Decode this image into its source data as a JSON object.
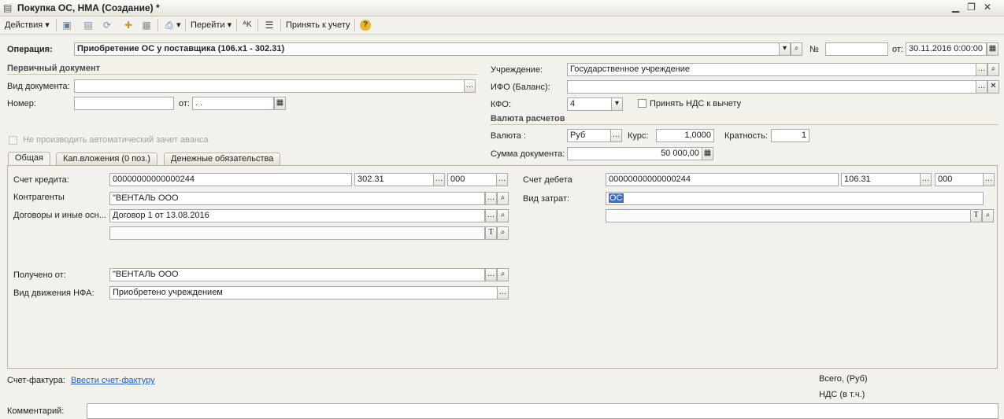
{
  "window": {
    "title": "Покупка ОС, НМА (Создание) *",
    "controls": [
      "minimize-icon",
      "restore-icon",
      "close-icon"
    ]
  },
  "toolbar": {
    "actions": "Действия",
    "goto": "Перейти",
    "accept": "Принять к учету",
    "help": "?"
  },
  "header": {
    "operation_label": "Операция:",
    "operation_value": "Приобретение ОС у поставщика (106.х1 - 302.31)",
    "num_label": "№",
    "num_value": "",
    "date_label": "от:",
    "date_value": "30.11.2016  0:00:00"
  },
  "primary_doc": {
    "section": "Первичный документ",
    "doc_type_label": "Вид документа:",
    "doc_type_value": "",
    "number_label": "Номер:",
    "number_value": "",
    "date_label": "от:",
    "date_value": "  .  .  ",
    "no_auto_advance": "Не производить автоматический зачет аванса"
  },
  "institution": {
    "label": "Учреждение:",
    "value": "Государственное учреждение",
    "ifo_label": "ИФО (Баланс):",
    "ifo_value": "",
    "kfo_label": "КФО:",
    "kfo_value": "4",
    "vat_label": "Принять НДС к вычету"
  },
  "currency": {
    "section": "Валюта расчетов",
    "currency_label": "Валюта :",
    "currency_value": "Руб",
    "rate_label": "Курс:",
    "rate_value": "1,0000",
    "mult_label": "Кратность:",
    "mult_value": "1",
    "sum_label": "Сумма документа:",
    "sum_value": "50 000,00"
  },
  "tabs": [
    "Общая",
    "Кап.вложения (0 поз.)",
    "Денежные обязательства"
  ],
  "general": {
    "credit_label": "Счет кредита:",
    "credit_acc": "00000000000000244",
    "credit_sub": "302.31",
    "credit_kosgu": "000",
    "contractors_label": "Контрагенты",
    "contractor_value": "\"ВЕНТАЛЬ ООО",
    "contracts_label": "Договоры и иные осн...",
    "contract_value": "Договор 1 от 13.08.2016",
    "contract_extra": "",
    "received_label": "Получено от:",
    "received_value": "\"ВЕНТАЛЬ ООО",
    "movement_label": "Вид движения НФА:",
    "movement_value": "Приобретено учреждением",
    "debit_label": "Счет дебета",
    "debit_acc": "00000000000000244",
    "debit_sub": "106.31",
    "debit_kosgu": "000",
    "cost_label": "Вид затрат:",
    "cost_value": "ОС",
    "cost_extra": ""
  },
  "footer": {
    "invoice_label": "Счет-фактура:",
    "invoice_link": "Ввести счет-фактуру",
    "total_label": "Всего, (Руб)",
    "vat_label": "НДС (в т.ч.)",
    "comment_label": "Комментарий:"
  }
}
